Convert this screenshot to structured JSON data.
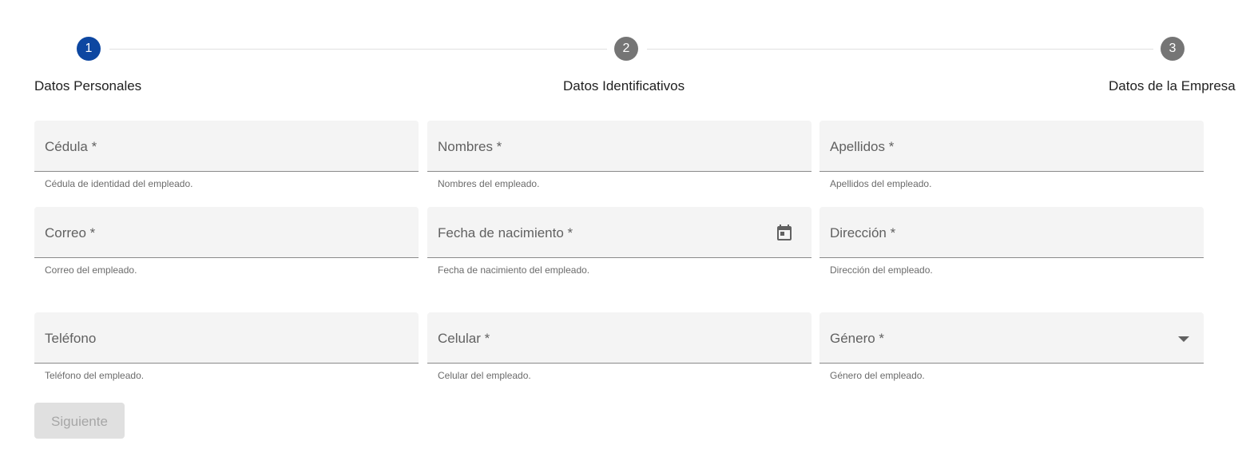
{
  "stepper": {
    "steps": [
      {
        "number": "1",
        "label": "Datos Personales",
        "state": "active"
      },
      {
        "number": "2",
        "label": "Datos Identificativos",
        "state": "inactive"
      },
      {
        "number": "3",
        "label": "Datos de la Empresa",
        "state": "inactive"
      }
    ]
  },
  "form": {
    "fields": [
      {
        "label": "Cédula *",
        "hint": "Cédula de identidad del empleado.",
        "icon": ""
      },
      {
        "label": "Nombres *",
        "hint": "Nombres del empleado.",
        "icon": ""
      },
      {
        "label": "Apellidos *",
        "hint": "Apellidos del empleado.",
        "icon": ""
      },
      {
        "label": "Correo *",
        "hint": "Correo del empleado.",
        "icon": ""
      },
      {
        "label": "Fecha de nacimiento *",
        "hint": "Fecha de nacimiento del empleado.",
        "icon": "calendar-icon"
      },
      {
        "label": "Dirección *",
        "hint": "Dirección del empleado.",
        "icon": ""
      },
      {
        "label": "Teléfono",
        "hint": "Teléfono del empleado.",
        "icon": ""
      },
      {
        "label": "Celular *",
        "hint": "Celular del empleado.",
        "icon": ""
      },
      {
        "label": "Género *",
        "hint": "Género del empleado.",
        "icon": "dropdown-arrow-icon"
      }
    ],
    "next_button": {
      "label": "Siguiente",
      "enabled": false
    }
  },
  "colors": {
    "accent": "#0d47a1",
    "inactive_step": "#757575",
    "field_bg": "#f4f4f4",
    "disabled_button_bg": "#e0e0e0",
    "disabled_button_text": "#a6a6a6"
  }
}
